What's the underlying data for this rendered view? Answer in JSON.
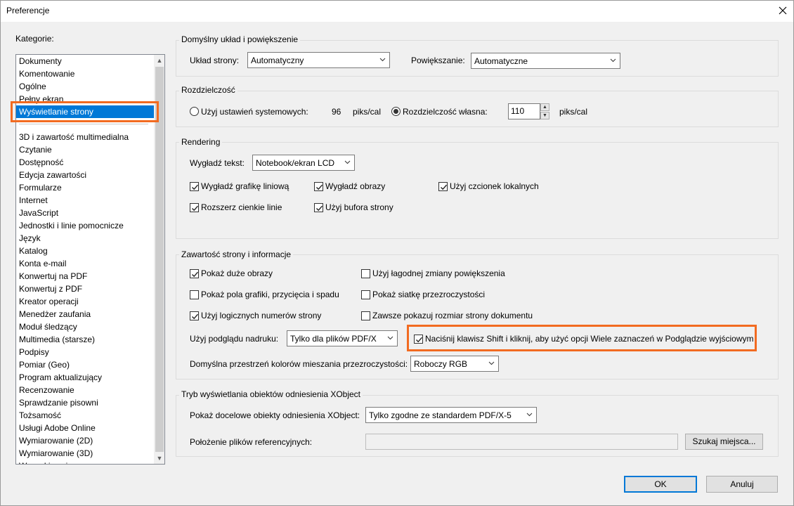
{
  "window": {
    "title": "Preferencje",
    "close_icon": "close-icon"
  },
  "categories": {
    "label": "Kategorie:",
    "top_items": [
      "Dokumenty",
      "Komentowanie",
      "Ogólne",
      "Pełny ekran",
      "Wyświetlanie strony"
    ],
    "selected": "Wyświetlanie strony",
    "items": [
      "3D i zawartość multimedialna",
      "Czytanie",
      "Dostępność",
      "Edycja zawartości",
      "Formularze",
      "Internet",
      "JavaScript",
      "Jednostki i linie pomocnicze",
      "Język",
      "Katalog",
      "Konta e-mail",
      "Konwertuj na PDF",
      "Konwertuj z PDF",
      "Kreator operacji",
      "Menedżer zaufania",
      "Moduł śledzący",
      "Multimedia (starsze)",
      "Podpisy",
      "Pomiar (Geo)",
      "Program aktualizujący",
      "Recenzowanie",
      "Sprawdzanie pisowni",
      "Tożsamość",
      "Usługi Adobe Online",
      "Wymiarowanie (2D)",
      "Wymiarowanie (3D)",
      "Wyszukiwanie"
    ]
  },
  "layout_zoom": {
    "legend": "Domyślny układ i powiększenie",
    "page_layout_label": "Układ strony:",
    "page_layout_value": "Automatyczny",
    "zoom_label": "Powiększanie:",
    "zoom_value": "Automatyczne"
  },
  "resolution": {
    "legend": "Rozdzielczość",
    "system_label": "Użyj ustawień systemowych:",
    "system_value": "96",
    "system_unit": "piks/cal",
    "custom_label": "Rozdzielczość własna:",
    "custom_value": "110",
    "custom_unit": "piks/cal",
    "selected": "custom"
  },
  "rendering": {
    "legend": "Rendering",
    "smooth_text_label": "Wygładź tekst:",
    "smooth_text_value": "Notebook/ekran LCD",
    "options": [
      {
        "label": "Wygładź grafikę liniową",
        "checked": true
      },
      {
        "label": "Wygładź obrazy",
        "checked": true
      },
      {
        "label": "Użyj czcionek lokalnych",
        "checked": true
      },
      {
        "label": "Rozszerz cienkie linie",
        "checked": true
      },
      {
        "label": "Użyj bufora strony",
        "checked": true
      }
    ]
  },
  "content": {
    "legend": "Zawartość strony i informacje",
    "options": [
      {
        "label": "Pokaż duże obrazy",
        "checked": true
      },
      {
        "label": "Użyj łagodnej zmiany powiększenia",
        "checked": false
      },
      {
        "label": "Pokaż pola grafiki, przycięcia i spadu",
        "checked": false
      },
      {
        "label": "Pokaż siatkę przezroczystości",
        "checked": false
      },
      {
        "label": "Użyj logicznych numerów strony",
        "checked": true
      },
      {
        "label": "Zawsze pokazuj rozmiar strony dokumentu",
        "checked": false
      }
    ],
    "overprint_label": "Użyj podglądu nadruku:",
    "overprint_value": "Tylko dla plików PDF/X",
    "shift_click_label": "Naciśnij klawisz Shift i kliknij, aby użyć opcji Wiele zaznaczeń w Podglądzie wyjściowym",
    "shift_click_checked": true,
    "blend_space_label": "Domyślna przestrzeń kolorów mieszania przezroczystości:",
    "blend_space_value": "Roboczy RGB"
  },
  "xobject": {
    "legend": "Tryb wyświetlania obiektów odniesienia XObject",
    "show_label": "Pokaż docelowe obiekty odniesienia XObject:",
    "show_value": "Tylko zgodne ze standardem PDF/X-5",
    "location_label": "Położenie plików referencyjnych:",
    "location_value": "",
    "browse_label": "Szukaj miejsca..."
  },
  "buttons": {
    "ok": "OK",
    "cancel": "Anuluj"
  },
  "colors": {
    "selection": "#0078d7",
    "highlight": "#f26b21"
  }
}
